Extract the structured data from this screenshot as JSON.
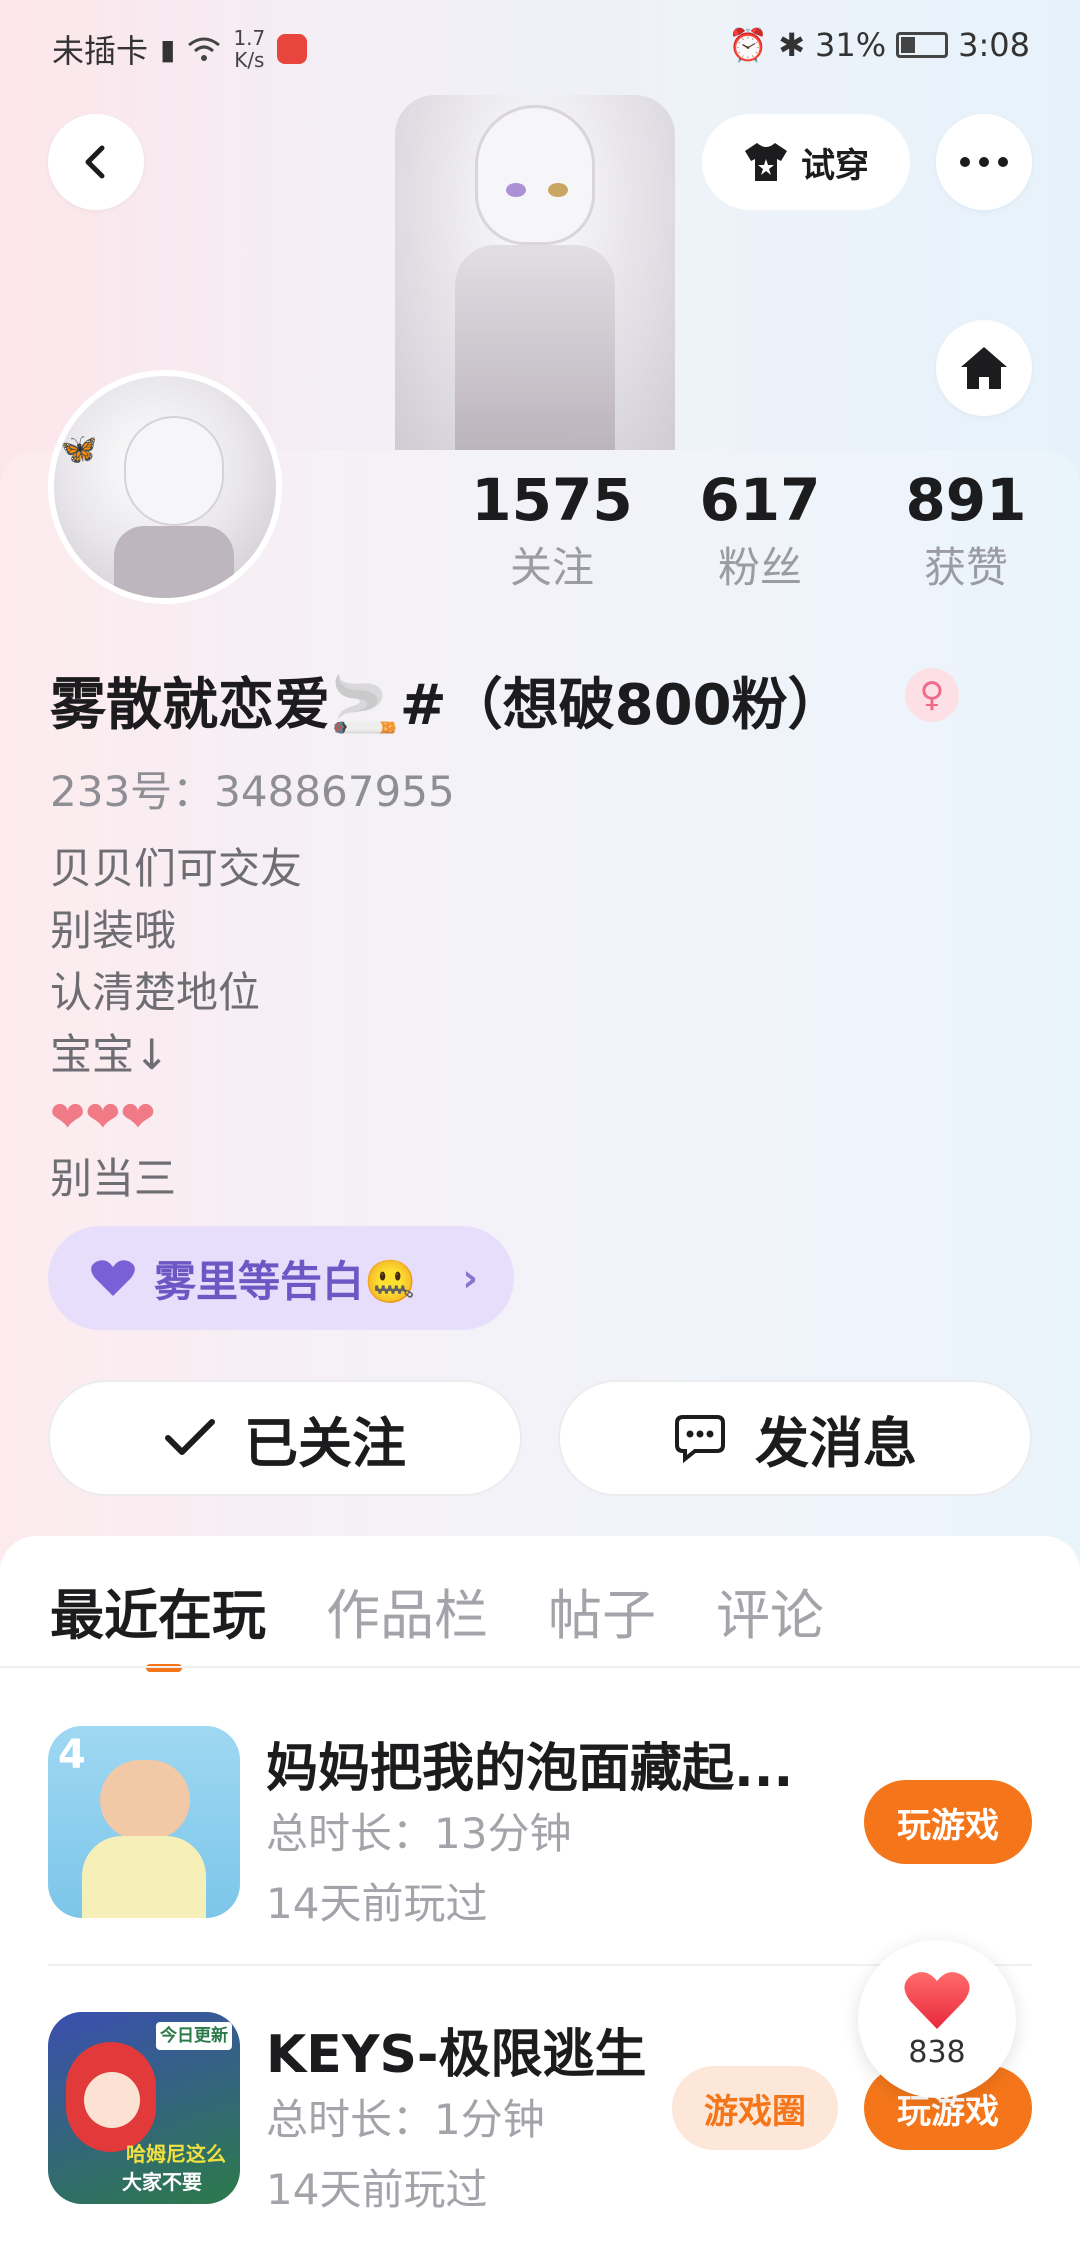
{
  "status_bar": {
    "carrier": "未插卡",
    "speed_value": "1.7",
    "speed_unit": "K/s",
    "battery": "31%",
    "time": "3:08"
  },
  "header": {
    "try_on_label": "试穿"
  },
  "profile": {
    "stats": [
      {
        "value": "1575",
        "label": "关注"
      },
      {
        "value": "617",
        "label": "粉丝"
      },
      {
        "value": "891",
        "label": "获赞"
      }
    ],
    "nickname": "雾散就恋爱🚬#（想破800粉）",
    "gender_symbol": "♀",
    "uid": "233号：348867955",
    "bio_lines": [
      "贝贝们可交友",
      "别装哦",
      "认清楚地位",
      "宝宝↓",
      "❤❤❤",
      "别当三"
    ],
    "confession_label": "雾里等告白🤐",
    "followed_label": "已关注",
    "message_label": "发消息"
  },
  "tabs": [
    "最近在玩",
    "作品栏",
    "帖子",
    "评论"
  ],
  "games": [
    {
      "title": "妈妈把我的泡面藏起...",
      "duration": "总时长：13分钟",
      "last_played": "14天前玩过",
      "play_label": "玩游戏"
    },
    {
      "title": "KEYS-极限逃生",
      "duration": "总时长：1分钟",
      "last_played": "14天前玩过",
      "play_label": "玩游戏",
      "circle_label": "游戏圈",
      "icon_texts": [
        "今日更新",
        "哈姆尼这么",
        "大家不要"
      ]
    }
  ],
  "like_fab": {
    "count": "838"
  },
  "colors": {
    "accent": "#f5761a",
    "confess_bg": "#e6defa",
    "confess_text": "#6b58c4"
  }
}
